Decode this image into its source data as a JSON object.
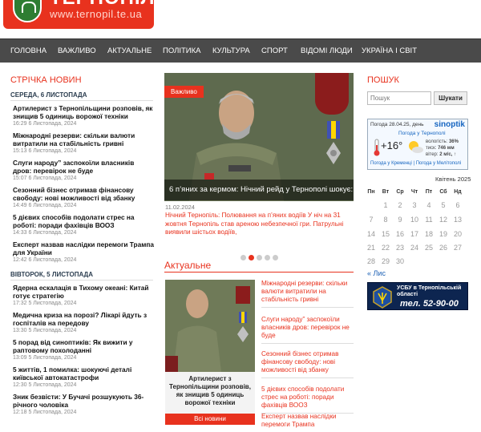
{
  "header": {
    "logo_title": "ТЕРНОПІЛЬ",
    "logo_url": "www.ternopil.te.ua"
  },
  "nav": {
    "items": [
      "ГОЛОВНА",
      "ВАЖЛИВО",
      "АКТУАЛЬНЕ",
      "ПОЛІТИКА",
      "КУЛЬТУРА",
      "СПОРТ",
      "ВІДОМІ ЛЮДИ",
      "УКРАЇНА І СВІТ"
    ]
  },
  "news_feed": {
    "title": "СТРІЧКА НОВИН",
    "day1": "СЕРЕДА, 6 ЛИСТОПАДА",
    "day2": "ВІВТОРОК, 5 ЛИСТОПАДА",
    "items": [
      {
        "title": "Артилерист з Тернопільщини розповів, як знищив 5 одиниць ворожої техніки",
        "time": "16:29 6 Листопада, 2024"
      },
      {
        "title": "Міжнародні резерви: скільки валюти витратили на стабільність гривні",
        "time": "15:13 6 Листопада, 2024"
      },
      {
        "title": "Слуги народу” заспокоїли власників дров: перевірок не буде",
        "time": "15:07 6 Листопада, 2024"
      },
      {
        "title": "Сезонний бізнес отримав фінансову свободу: нові можливості від збанку",
        "time": "14:49 6 Листопада, 2024"
      },
      {
        "title": "5 дієвих способів подолати стрес на роботі: поради фахівців ВООЗ",
        "time": "14:33 6 Листопада, 2024"
      },
      {
        "title": "Експерт назвав наслідки перемоги Трампа для України",
        "time": "12:42 6 Листопада, 2024"
      },
      {
        "title": "Ядерна ескалація в Тихому океані: Китай готує стратегію",
        "time": "17:32 5 Листопада, 2024"
      },
      {
        "title": "Медична криза на порозі? Лікарі йдуть з госпіталів на передову",
        "time": "13:30 5 Листопада, 2024"
      },
      {
        "title": "5 порад від синоптиків: Як вижити у раптовому похолоданні",
        "time": "13:09 5 Листопада, 2024"
      },
      {
        "title": "5 життів, 1 помилка: шокуючі деталі київської автокатастрофи",
        "time": "12:30 5 Листопада, 2024"
      },
      {
        "title": "Зник безвісти: У Бучачі розшукують 36-річного чоловіка",
        "time": "12:18 5 Листопада, 2024"
      }
    ]
  },
  "slider": {
    "badge": "Важливо",
    "caption": "6 п’яних за кермом: Нічний рейд у Тернополі шокує:",
    "date": "11.02.2024",
    "text": "Нічний Тернопіль: Полювання на п’яних водіїв У ніч на 31 жовтня Тернопіль став ареною небезпечної гри. Патрульні виявили шістьох водіїв,"
  },
  "actual": {
    "title": "Актуальне",
    "photo_caption": "Артилерист з Тернопільщини розповів, як знищив 5 одиниць ворожої техніки",
    "all_news": "Всі новини",
    "items": [
      "Міжнародні резерви: скільки валюти витратили на стабільність гривні",
      "Слуги народу” заспокоїли власників дров: перевірок не буде",
      "Сезонний бізнес отримав фінансову свободу: нові можливості від збанку",
      "5 дієвих способів подолати стрес на роботі: поради фахівців ВООЗ",
      "Експерт назвав наслідки перемоги Трампа"
    ]
  },
  "search": {
    "title": "ПОШУК",
    "placeholder": "Пошук",
    "button": "Шукати"
  },
  "weather": {
    "date": "Погода 28.04.25, день",
    "brand": "sinoptik",
    "city": "Погода у Тернополі",
    "temp": "+16°",
    "humidity_label": "вологість:",
    "humidity": "36%",
    "pressure_label": "тиск:",
    "pressure": "746 мм",
    "wind_label": "вітер:",
    "wind": "2 м/с, ↑",
    "link1": "Погода у Кременці",
    "link2": "Погода у Мелітополі"
  },
  "calendar": {
    "title": "Квітень 2025",
    "weekdays": [
      "Пн",
      "Вт",
      "Ср",
      "Чт",
      "Пт",
      "Сб",
      "Нд"
    ],
    "rows": [
      [
        "",
        "1",
        "2",
        "3",
        "4",
        "5",
        "6"
      ],
      [
        "7",
        "8",
        "9",
        "10",
        "11",
        "12",
        "13"
      ],
      [
        "14",
        "15",
        "16",
        "17",
        "18",
        "19",
        "20"
      ],
      [
        "21",
        "22",
        "23",
        "24",
        "25",
        "26",
        "27"
      ],
      [
        "28",
        "29",
        "30",
        "",
        "",
        "",
        ""
      ]
    ],
    "prev": "« Лис"
  },
  "banner": {
    "line1": "УСБУ в Тернопільській області",
    "line2": "тел. 52-90-00"
  },
  "colors": {
    "accent": "#e8321e",
    "nav_bg": "#4a4a4a"
  }
}
